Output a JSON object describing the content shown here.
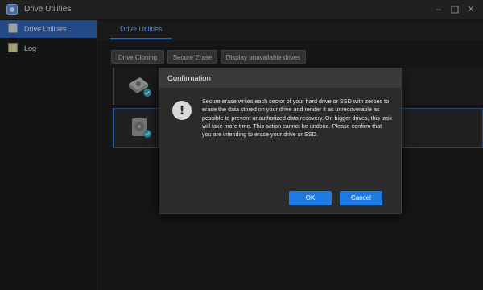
{
  "window": {
    "title": "Drive Utilities",
    "icon": "drive-utilities-app-icon",
    "controls": [
      "minimize-icon",
      "maximize-icon",
      "close-icon"
    ]
  },
  "sidebar": {
    "items": [
      {
        "label": "Drive Utilities",
        "icon": "drive-icon",
        "active": true
      },
      {
        "label": "Log",
        "icon": "notepad-icon",
        "active": false
      }
    ]
  },
  "main": {
    "tabs": [
      {
        "label": "Drive Utilities"
      }
    ],
    "toolbar": {
      "drive_cloning": "Drive Cloning",
      "secure_erase": "Secure Erase",
      "display_unavailable": "Display unavailable drives"
    },
    "drives": [
      {
        "icon": "hard-drive-icon",
        "status_icon": "check-badge-icon",
        "selected": false
      },
      {
        "icon": "ssd-icon",
        "status_icon": "check-badge-icon",
        "selected": true
      }
    ]
  },
  "dialog": {
    "title": "Confirmation",
    "icon": "exclamation-icon",
    "message": "Secure erase writes each sector of your hard drive or SSD with zeroes to erase the data stored on your drive and render it as unrecoverable as possible to prevent unauthorized data recovery. On bigger drives, this task will take more time. This action cannot be undone. Please confirm that you are intending to erase your drive or SSD.",
    "ok_label": "OK",
    "cancel_label": "Cancel"
  },
  "colors": {
    "accent": "#1d7be3",
    "sidebar_active": "#2f63b5"
  }
}
